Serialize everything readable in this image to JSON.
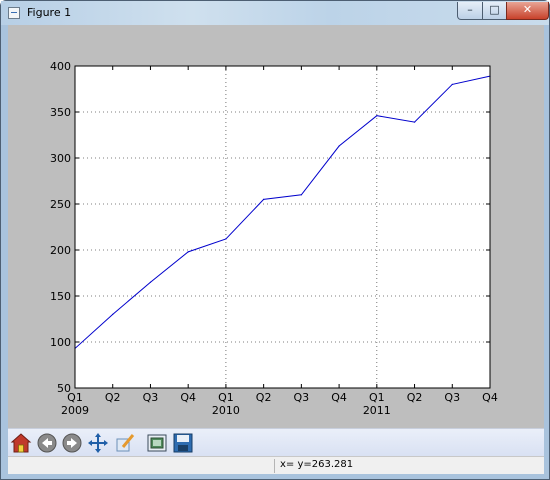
{
  "window": {
    "title": "Figure 1",
    "minimize_glyph": "–",
    "maximize_glyph": "□",
    "close_glyph": "✕"
  },
  "toolbar": {
    "buttons": [
      {
        "name": "home-icon"
      },
      {
        "name": "back-icon"
      },
      {
        "name": "forward-icon"
      },
      {
        "name": "pan-icon"
      },
      {
        "name": "zoom-icon"
      },
      {
        "name": "subplots-icon"
      },
      {
        "name": "save-icon"
      }
    ]
  },
  "status": {
    "text": "x= y=263.281"
  },
  "chart_data": {
    "type": "line",
    "categories": [
      "Q1",
      "Q2",
      "Q3",
      "Q4",
      "Q1",
      "Q2",
      "Q3",
      "Q4",
      "Q1",
      "Q2",
      "Q3",
      "Q4"
    ],
    "year_labels": [
      "2009",
      "2010",
      "2011"
    ],
    "values": [
      93,
      130,
      165,
      198,
      212,
      255,
      260,
      313,
      346,
      339,
      380,
      389
    ],
    "ylim": [
      50,
      400
    ],
    "yticks": [
      "50",
      "100",
      "150",
      "200",
      "250",
      "300",
      "350",
      "400"
    ],
    "grid": true,
    "line_color": "#0000cc",
    "title": "",
    "xlabel": "",
    "ylabel": ""
  }
}
